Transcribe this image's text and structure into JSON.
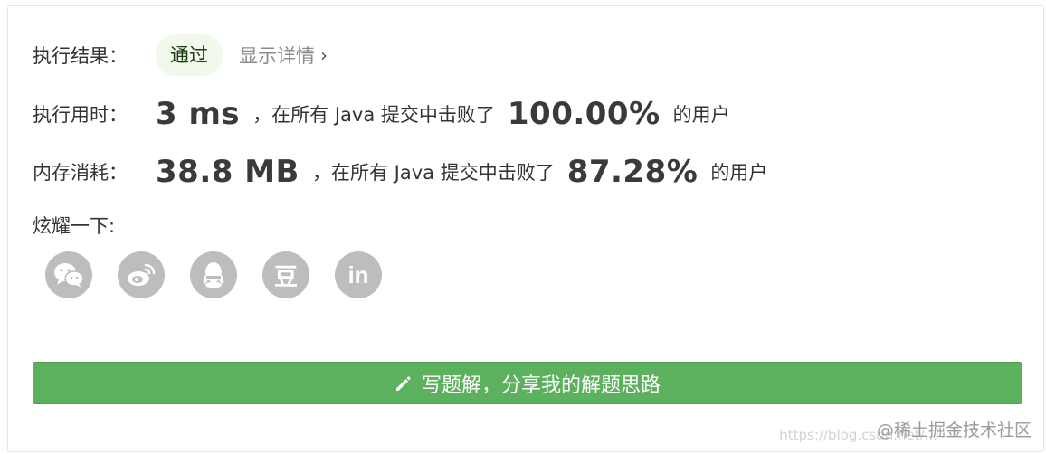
{
  "result": {
    "label": "执行结果：",
    "status": "通过",
    "details_link": "显示详情",
    "chevron": "›"
  },
  "runtime": {
    "label": "执行用时：",
    "value": "3 ms",
    "text_before": "，在所有 Java 提交中击败了",
    "percent": "100.00%",
    "text_after": "的用户"
  },
  "memory": {
    "label": "内存消耗：",
    "value": "38.8 MB",
    "text_before": "，在所有 Java 提交中击败了",
    "percent": "87.28%",
    "text_after": "的用户"
  },
  "share": {
    "label": "炫耀一下:",
    "icons": [
      "wechat-icon",
      "weibo-icon",
      "qq-icon",
      "douban-icon",
      "linkedin-icon"
    ],
    "douban_glyph": "豆",
    "linkedin_glyph": "in"
  },
  "write_button": {
    "label": "写题解，分享我的解题思路",
    "icon": "pencil-icon"
  },
  "watermark": {
    "text": "@稀土掘金技术社区",
    "url": "https://blog.csdn.net/..."
  },
  "colors": {
    "button_green": "#5cb15e",
    "pass_badge_bg": "#f1f8ec",
    "icon_gray": "#bdbdbd"
  }
}
